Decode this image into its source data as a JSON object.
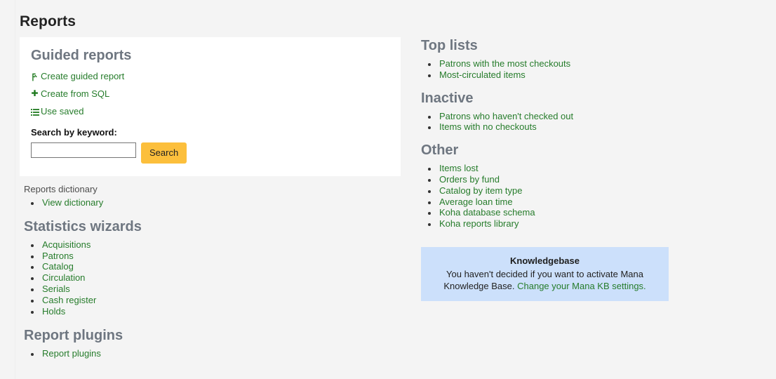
{
  "page": {
    "title": "Reports"
  },
  "guided": {
    "heading": "Guided reports",
    "links": [
      {
        "label": "Create guided report",
        "icon": "magic-wand-icon"
      },
      {
        "label": "Create from SQL",
        "icon": "plus-icon"
      },
      {
        "label": "Use saved",
        "icon": "list-icon"
      }
    ],
    "search": {
      "label": "Search by keyword:",
      "value": "",
      "placeholder": "",
      "button_label": "Search"
    }
  },
  "dictionary": {
    "heading": "Reports dictionary",
    "items": [
      {
        "label": "View dictionary"
      }
    ]
  },
  "statistics_wizards": {
    "heading": "Statistics wizards",
    "items": [
      {
        "label": "Acquisitions"
      },
      {
        "label": "Patrons"
      },
      {
        "label": "Catalog"
      },
      {
        "label": "Circulation"
      },
      {
        "label": "Serials"
      },
      {
        "label": "Cash register"
      },
      {
        "label": "Holds"
      }
    ]
  },
  "report_plugins": {
    "heading": "Report plugins",
    "items": [
      {
        "label": "Report plugins"
      }
    ]
  },
  "top_lists": {
    "heading": "Top lists",
    "items": [
      {
        "label": "Patrons with the most checkouts"
      },
      {
        "label": "Most-circulated items"
      }
    ]
  },
  "inactive": {
    "heading": "Inactive",
    "items": [
      {
        "label": "Patrons who haven't checked out"
      },
      {
        "label": "Items with no checkouts"
      }
    ]
  },
  "other": {
    "heading": "Other",
    "items": [
      {
        "label": "Items lost"
      },
      {
        "label": "Orders by fund"
      },
      {
        "label": "Catalog by item type"
      },
      {
        "label": "Average loan time"
      },
      {
        "label": "Koha database schema"
      },
      {
        "label": "Koha reports library"
      }
    ]
  },
  "knowledgebase": {
    "title": "Knowledgebase",
    "text": "You haven't decided if you want to activate Mana Knowledge Base. ",
    "link_label": "Change your Mana KB settings."
  },
  "colors": {
    "page_background": "#f4f4f4",
    "card_background": "#ffffff",
    "link_green": "#267c2b",
    "heading_gray": "#6e7680",
    "button_amber": "#fcbf3c",
    "kb_blue": "#cce0fb"
  }
}
